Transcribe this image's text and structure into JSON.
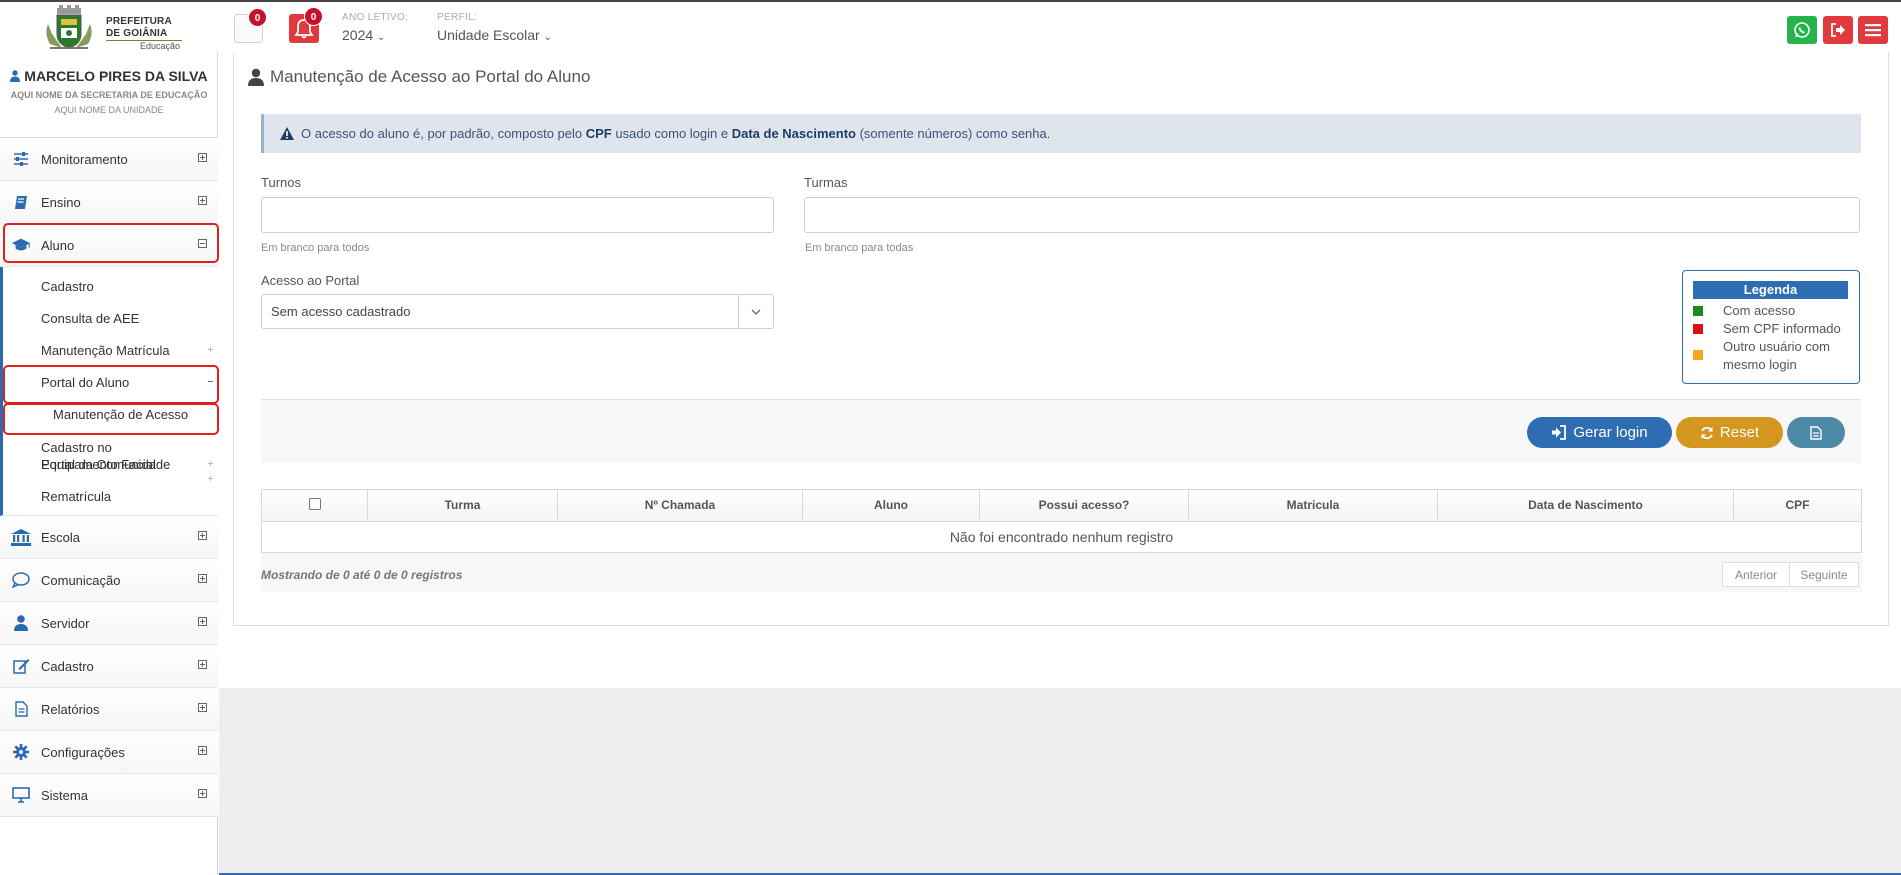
{
  "header": {
    "logo": {
      "line1": "PREFEITURA",
      "line2": "DE GOIÂNIA",
      "line3": "Educação"
    },
    "messages_count": "0",
    "notifications_count": "0",
    "ano_letivo_label": "ANO LETIVO:",
    "ano_letivo_value": "2024",
    "perfil_label": "PERFIL:",
    "perfil_value": "Unidade Escolar",
    "colors": {
      "whatsapp": "#25b34a",
      "logout": "#e0393e",
      "menu": "#e0393e"
    }
  },
  "user": {
    "name": "MARCELO PIRES DA SILVA",
    "secretaria": "AQUI NOME DA SECRETARIA DE EDUCAÇÃO",
    "unidade": "AQUI NOME DA UNIDADE"
  },
  "sidebar": {
    "items": [
      {
        "label": "Monitoramento",
        "icon": "sliders-icon"
      },
      {
        "label": "Ensino",
        "icon": "book-icon"
      },
      {
        "label": "Aluno",
        "icon": "graduation-cap-icon"
      },
      {
        "label": "Escola",
        "icon": "bank-icon"
      },
      {
        "label": "Comunicação",
        "icon": "chat-icon"
      },
      {
        "label": "Servidor",
        "icon": "user-icon"
      },
      {
        "label": "Cadastro",
        "icon": "edit-icon"
      },
      {
        "label": "Relatórios",
        "icon": "document-icon"
      },
      {
        "label": "Configurações",
        "icon": "gear-icon"
      },
      {
        "label": "Sistema",
        "icon": "monitor-icon"
      }
    ],
    "aluno_submenu": [
      "Cadastro",
      "Consulta de AEE",
      "Manutenção Matrícula",
      "Portal do Aluno",
      "Manutenção de Acesso",
      "Cadastro no Equipamento Facial",
      "Portal da Comunidade",
      "Rematrícula"
    ]
  },
  "page": {
    "title": "Manutenção de Acesso ao Portal do Aluno",
    "alert": {
      "t1": "O acesso do aluno é, por padrão, composto pelo ",
      "b1": "CPF",
      "t2": " usado como login e ",
      "b2": "Data de Nascimento",
      "t3": " (somente números) como senha."
    },
    "turnos_label": "Turnos",
    "turnos_help": "Em branco para todos",
    "turmas_label": "Turmas",
    "turmas_help": "Em branco para todas",
    "acesso_label": "Acesso ao Portal",
    "acesso_value": "Sem acesso cadastrado",
    "legend": {
      "title": "Legenda",
      "items": [
        {
          "label": "Com acesso",
          "color": "#1e8a1e"
        },
        {
          "label": "Sem CPF informado",
          "color": "#e01010"
        },
        {
          "label": "Outro usuário com mesmo login",
          "color": "#f5a623"
        }
      ]
    },
    "buttons": {
      "gerar_login": "Gerar login",
      "reset": "Reset",
      "colors": {
        "gerar": "#2f6db2",
        "reset": "#d4961e",
        "doc": "#4d8aa8"
      }
    },
    "table": {
      "columns": [
        "Turma",
        "Nº Chamada",
        "Aluno",
        "Possui acesso?",
        "Matricula",
        "Data de Nascimento",
        "CPF"
      ],
      "empty_message": "Não foi encontrado nenhum registro"
    },
    "footer": {
      "info": "Mostrando de 0 até 0 de 0 registros",
      "prev": "Anterior",
      "next": "Seguinte"
    }
  }
}
